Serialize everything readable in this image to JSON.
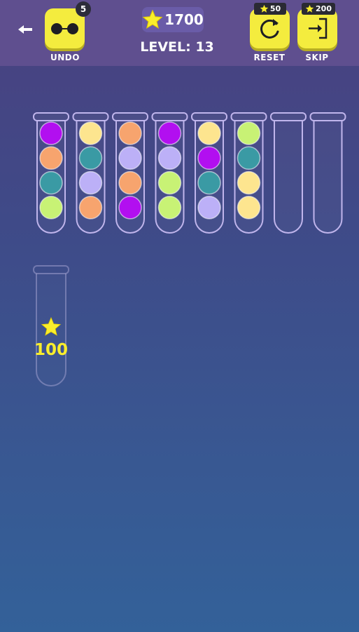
{
  "header": {
    "undo": {
      "label": "UNDO",
      "count": "5"
    },
    "coins": "1700",
    "level": "LEVEL: 13",
    "reset": {
      "label": "RESET",
      "cost": "50"
    },
    "skip": {
      "label": "SKIP",
      "cost": "200"
    }
  },
  "colors": {
    "purple": "#b20ff0",
    "orange": "#f7a46e",
    "teal": "#3a9aa4",
    "lime": "#c8f275",
    "yellow": "#fde58f",
    "lavender": "#bcb0f7",
    "accent_yellow": "#f4ec3e",
    "tube_outline": "#c0b5ec"
  },
  "tubes": [
    {
      "balls": [
        "purple",
        "orange",
        "teal",
        "lime"
      ]
    },
    {
      "balls": [
        "yellow",
        "teal",
        "lavender",
        "orange"
      ]
    },
    {
      "balls": [
        "orange",
        "lavender",
        "orange",
        "purple"
      ]
    },
    {
      "balls": [
        "purple",
        "lavender",
        "lime",
        "lime"
      ]
    },
    {
      "balls": [
        "yellow",
        "purple",
        "teal",
        "lavender"
      ]
    },
    {
      "balls": [
        "lime",
        "teal",
        "yellow",
        "yellow"
      ]
    },
    {
      "balls": []
    },
    {
      "balls": []
    }
  ],
  "bonus_tube": {
    "reward": "100",
    "icon": "star-icon"
  },
  "icons": {
    "back": "back-arrow-icon",
    "undo": "undo-icon",
    "coin": "star-icon",
    "reset": "reset-icon",
    "skip": "skip-icon"
  }
}
